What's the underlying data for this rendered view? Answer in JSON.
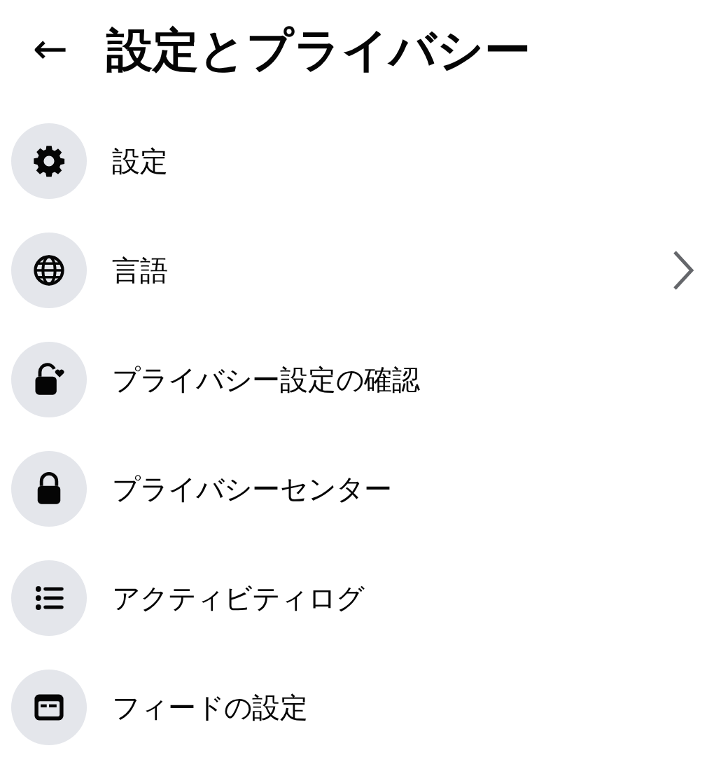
{
  "header": {
    "back": "←",
    "title": "設定とプライバシー"
  },
  "items": [
    {
      "kind": "gear",
      "label": "設定",
      "submenu": false
    },
    {
      "kind": "globe",
      "label": "言語",
      "submenu": true
    },
    {
      "kind": "lock-heart",
      "label": "プライバシー設定の確認",
      "submenu": false
    },
    {
      "kind": "lock",
      "label": "プライバシーセンター",
      "submenu": false
    },
    {
      "kind": "list",
      "label": "アクティビティログ",
      "submenu": false
    },
    {
      "kind": "feed",
      "label": "フィードの設定",
      "submenu": false
    }
  ]
}
